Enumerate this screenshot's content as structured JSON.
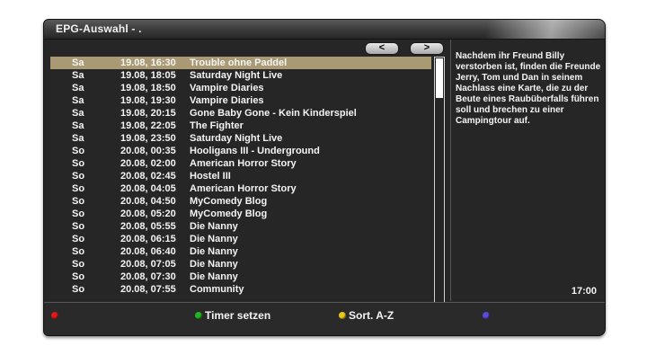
{
  "window": {
    "title": "EPG-Auswahl - ."
  },
  "nav": {
    "prev_label": "<",
    "next_label": ">"
  },
  "list": {
    "selected_index": 0,
    "rows": [
      {
        "day": "Sa",
        "datetime": "19.08, 16:30",
        "title": "Trouble ohne Paddel"
      },
      {
        "day": "Sa",
        "datetime": "19.08, 18:05",
        "title": "Saturday Night Live"
      },
      {
        "day": "Sa",
        "datetime": "19.08, 18:50",
        "title": "Vampire Diaries"
      },
      {
        "day": "Sa",
        "datetime": "19.08, 19:30",
        "title": "Vampire Diaries"
      },
      {
        "day": "Sa",
        "datetime": "19.08, 20:15",
        "title": "Gone Baby Gone - Kein Kinderspiel"
      },
      {
        "day": "Sa",
        "datetime": "19.08, 22:05",
        "title": "The Fighter"
      },
      {
        "day": "Sa",
        "datetime": "19.08, 23:50",
        "title": "Saturday Night Live"
      },
      {
        "day": "So",
        "datetime": "20.08, 00:35",
        "title": "Hooligans III - Underground"
      },
      {
        "day": "So",
        "datetime": "20.08, 02:00",
        "title": "American Horror Story"
      },
      {
        "day": "So",
        "datetime": "20.08, 02:45",
        "title": "Hostel III"
      },
      {
        "day": "So",
        "datetime": "20.08, 04:05",
        "title": "American Horror Story"
      },
      {
        "day": "So",
        "datetime": "20.08, 04:50",
        "title": "MyComedy Blog"
      },
      {
        "day": "So",
        "datetime": "20.08, 05:20",
        "title": "MyComedy Blog"
      },
      {
        "day": "So",
        "datetime": "20.08, 05:55",
        "title": "Die Nanny"
      },
      {
        "day": "So",
        "datetime": "20.08, 06:15",
        "title": "Die Nanny"
      },
      {
        "day": "So",
        "datetime": "20.08, 06:40",
        "title": "Die Nanny"
      },
      {
        "day": "So",
        "datetime": "20.08, 07:05",
        "title": "Die Nanny"
      },
      {
        "day": "So",
        "datetime": "20.08, 07:30",
        "title": "Die Nanny"
      },
      {
        "day": "So",
        "datetime": "20.08, 07:55",
        "title": "Community"
      }
    ]
  },
  "description": {
    "text": "Nachdem ihr Freund Billy verstorben ist, finden die Freunde Jerry, Tom und Dan in seinem Nachlass eine Karte, die zu der Beute eines Raubüberfalls führen soll und brechen zu einer Campingtour auf.",
    "time": "17:00"
  },
  "colors": {
    "selection": "#a99a74",
    "red": "#e01818",
    "green": "#1fb81f",
    "yellow": "#e8c81a",
    "blue": "#5a4ad8"
  },
  "keys": {
    "red": {
      "icon": "red-key-icon",
      "label": ""
    },
    "green": {
      "icon": "green-key-icon",
      "label": "Timer setzen"
    },
    "yellow": {
      "icon": "yellow-key-icon",
      "label": "Sort. A-Z"
    },
    "blue": {
      "icon": "blue-key-icon",
      "label": ""
    }
  }
}
